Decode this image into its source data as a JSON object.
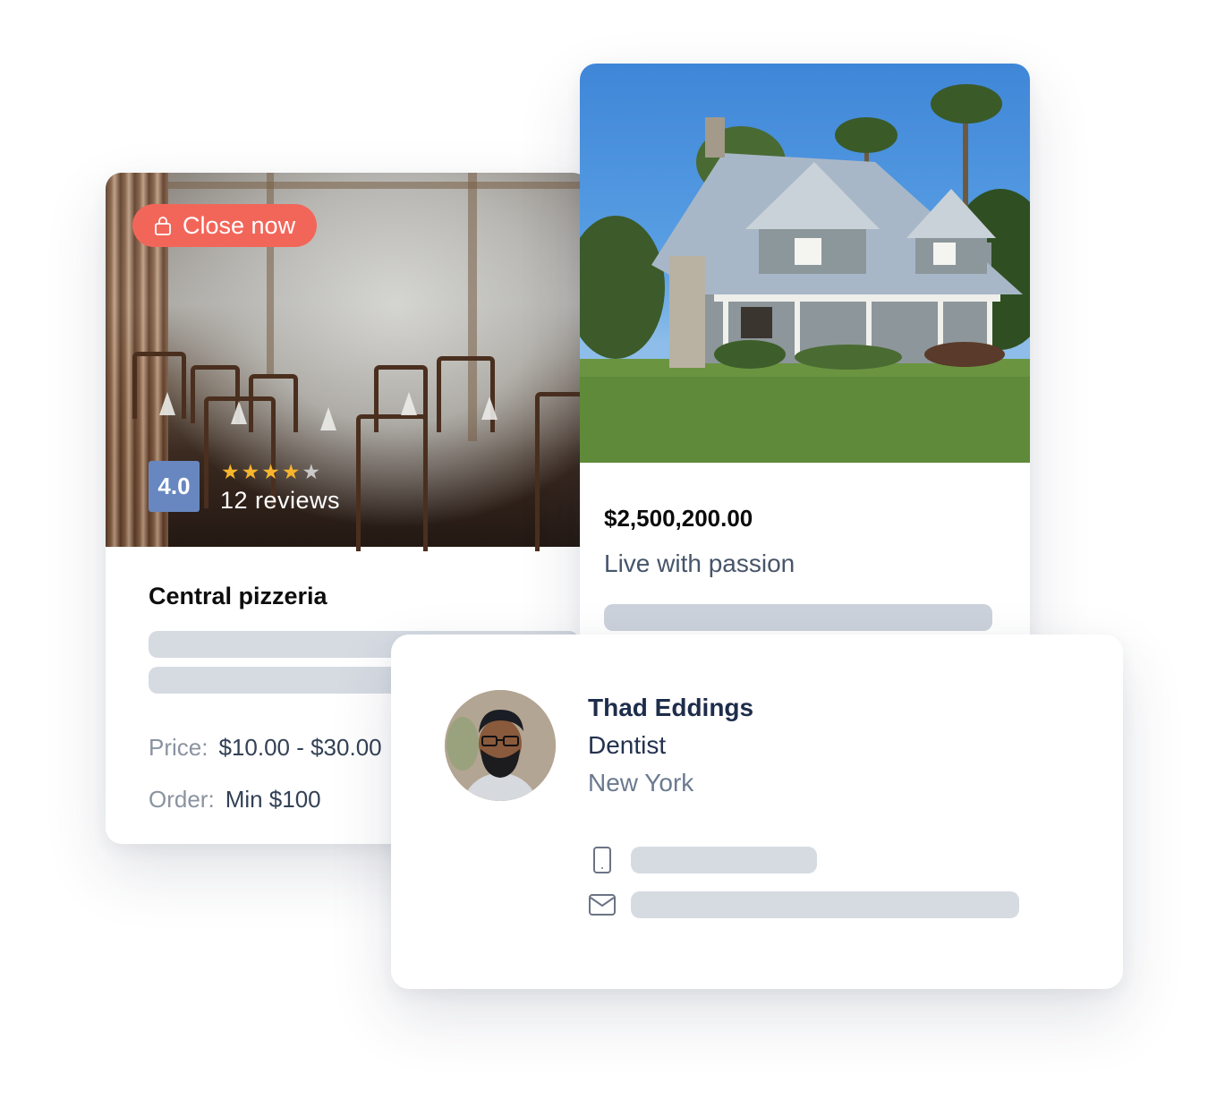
{
  "pizzeria_card": {
    "status_badge": {
      "icon": "lock-icon",
      "label": "Close now",
      "color": "#f2665a"
    },
    "rating": {
      "value": "4.0",
      "stars_filled": 4,
      "stars_total": 5,
      "reviews_label": "12 reviews",
      "badge_color": "#6887c0",
      "star_color": "#f6b52d"
    },
    "title": "Central pizzeria",
    "details": [
      {
        "label": "Price:",
        "value": "$10.00 - $30.00"
      },
      {
        "label": "Order:",
        "value": "Min $100"
      }
    ]
  },
  "house_card": {
    "price": "$2,500,200.00",
    "tagline": "Live with passion"
  },
  "person_card": {
    "name": "Thad Eddings",
    "role": "Dentist",
    "location": "New York",
    "contacts": [
      {
        "icon": "phone-icon"
      },
      {
        "icon": "mail-icon"
      }
    ]
  }
}
